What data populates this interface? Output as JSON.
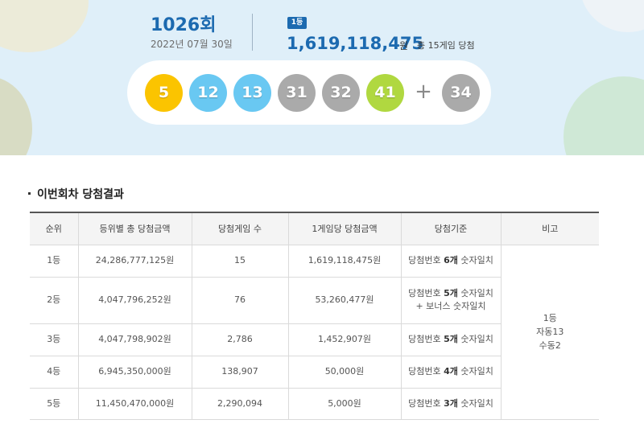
{
  "header": {
    "round_number": "1026",
    "round_suffix": "회",
    "draw_date": "2022년 07월 30일",
    "rank_badge": "1등",
    "first_prize_amount": "1,619,118,475",
    "prize_unit": "원",
    "winner_summary": "총 15게임 당첨"
  },
  "balls": [
    {
      "number": "5",
      "color": "#fbc400"
    },
    {
      "number": "12",
      "color": "#69c8f2"
    },
    {
      "number": "13",
      "color": "#69c8f2"
    },
    {
      "number": "31",
      "color": "#aaaaaa"
    },
    {
      "number": "32",
      "color": "#aaaaaa"
    },
    {
      "number": "41",
      "color": "#b0d840"
    }
  ],
  "plus_sign": "+",
  "bonus_ball": {
    "number": "34",
    "color": "#aaaaaa"
  },
  "section_title": "이번회차 당첨결과",
  "table": {
    "headers": [
      "순위",
      "등위별 총 당첨금액",
      "당첨게임 수",
      "1게임당 당첨금액",
      "당첨기준",
      "비고"
    ],
    "rows": [
      {
        "rank": "1등",
        "total": "24,286,777,125원",
        "games": "15",
        "per_game": "1,619,118,475원",
        "criteria_prefix": "당첨번호 ",
        "criteria_bold": "6개",
        "criteria_suffix": " 숫자일치",
        "criteria_line2": ""
      },
      {
        "rank": "2등",
        "total": "4,047,796,252원",
        "games": "76",
        "per_game": "53,260,477원",
        "criteria_prefix": "당첨번호 ",
        "criteria_bold": "5개",
        "criteria_suffix": " 숫자일치",
        "criteria_line2": "+ 보너스 숫자일치"
      },
      {
        "rank": "3등",
        "total": "4,047,798,902원",
        "games": "2,786",
        "per_game": "1,452,907원",
        "criteria_prefix": "당첨번호 ",
        "criteria_bold": "5개",
        "criteria_suffix": " 숫자일치",
        "criteria_line2": ""
      },
      {
        "rank": "4등",
        "total": "6,945,350,000원",
        "games": "138,907",
        "per_game": "50,000원",
        "criteria_prefix": "당첨번호 ",
        "criteria_bold": "4개",
        "criteria_suffix": " 숫자일치",
        "criteria_line2": ""
      },
      {
        "rank": "5등",
        "total": "11,450,470,000원",
        "games": "2,290,094",
        "per_game": "5,000원",
        "criteria_prefix": "당첨번호 ",
        "criteria_bold": "3개",
        "criteria_suffix": " 숫자일치",
        "criteria_line2": ""
      }
    ],
    "note_lines": [
      "1등",
      "자동13",
      "수동2"
    ]
  }
}
